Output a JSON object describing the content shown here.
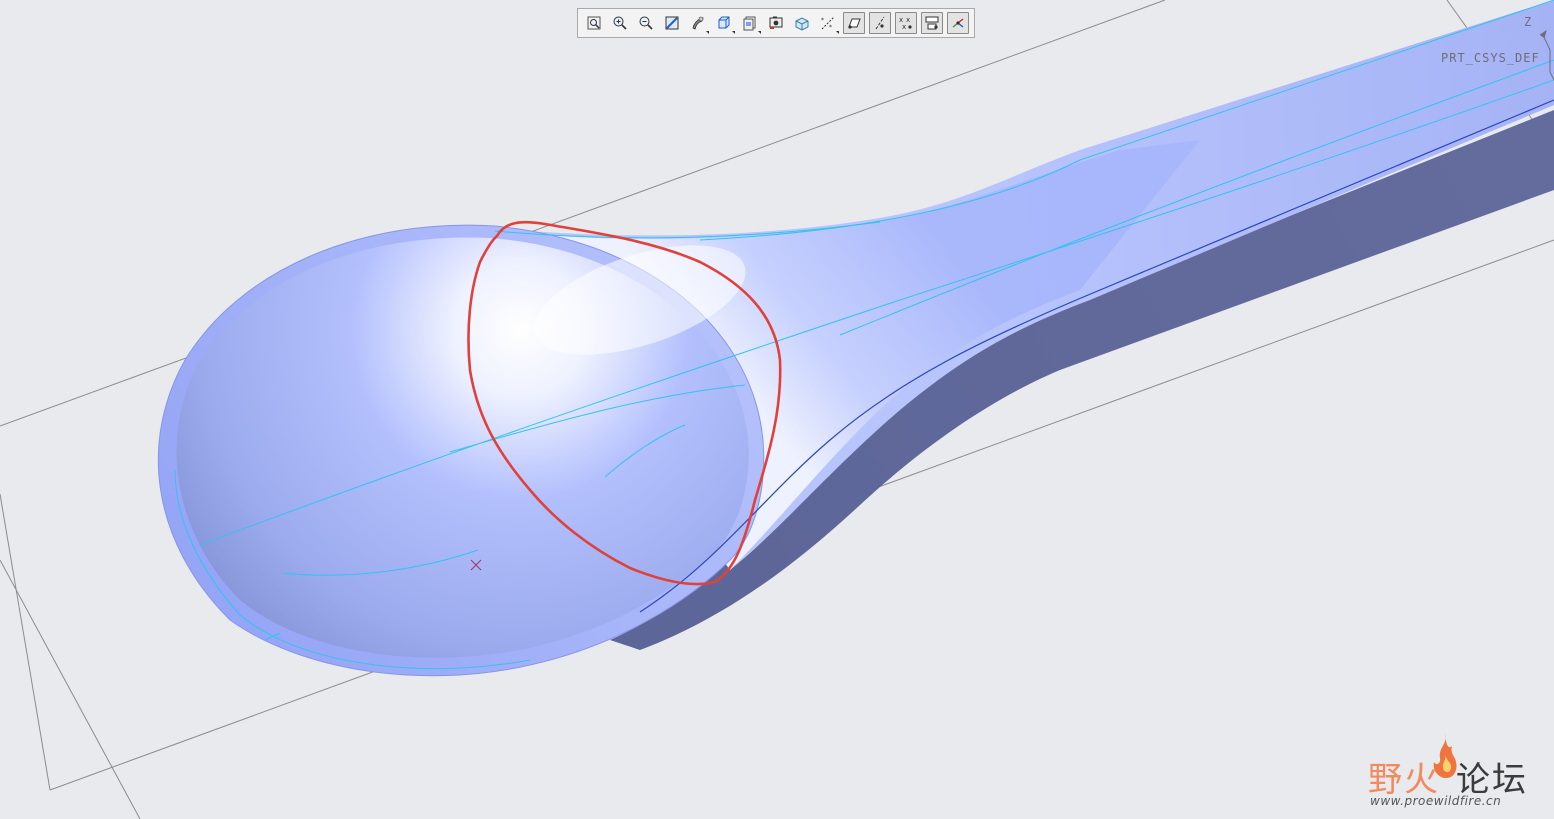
{
  "csys": {
    "name": "PRT_CSYS_DEF",
    "axis_z": "Z"
  },
  "toolbar": {
    "buttons": [
      {
        "icon": "refit-icon"
      },
      {
        "icon": "zoom-in-icon"
      },
      {
        "icon": "zoom-out-icon"
      },
      {
        "icon": "repaint-icon"
      },
      {
        "icon": "display-style-icon"
      },
      {
        "icon": "saved-orientations-icon"
      },
      {
        "icon": "view-manager-icon"
      },
      {
        "icon": "perspective-view-icon"
      },
      {
        "icon": "section-view-icon"
      },
      {
        "icon": "datum-display-icon"
      },
      {
        "icon": "plane-display-icon"
      },
      {
        "icon": "axis-display-icon"
      },
      {
        "icon": "point-display-icon"
      },
      {
        "icon": "csys-display-icon"
      },
      {
        "icon": "spin-center-icon"
      }
    ]
  },
  "watermark": {
    "title_part1": "野火",
    "title_part2": "论坛",
    "url": "www.proewildfire.cn"
  },
  "colors": {
    "background": "#e8eaed",
    "model_surface": "#a9b8fb",
    "model_shadow_side": "#5a6494",
    "edge_highlight": "#33c3ee",
    "annotation": "#e0413a",
    "watermark_accent": "#f28a5e"
  }
}
